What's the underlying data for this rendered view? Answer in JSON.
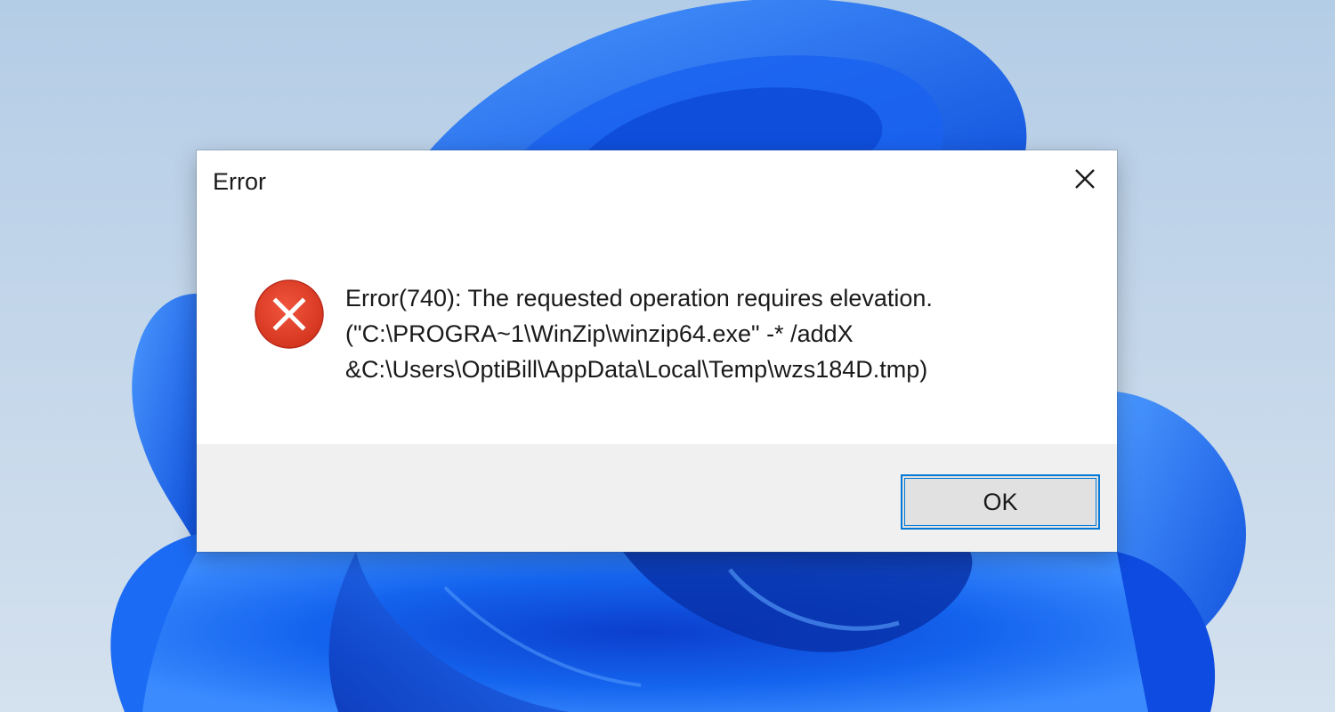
{
  "desktop": {
    "wallpaper": "windows-11-bloom",
    "colors": {
      "background": "#c3d6ea",
      "bloom_dark": "#0a3fd0",
      "bloom_mid": "#1667f0",
      "bloom_light": "#3d8cff"
    }
  },
  "dialog": {
    "title": "Error",
    "close_icon": "close-icon",
    "error_icon": "error-circle-x-icon",
    "message_lines": [
      "Error(740): The requested operation requires elevation.",
      " (\"C:\\PROGRA~1\\WinZip\\winzip64.exe\" -* /addX",
      "&C:\\Users\\OptiBill\\AppData\\Local\\Temp\\wzs184D.tmp)"
    ],
    "ok_label": "OK",
    "colors": {
      "icon_red": "#e3452f",
      "focus_border": "#0078d7",
      "footer_bg": "#f0f0f0"
    }
  }
}
